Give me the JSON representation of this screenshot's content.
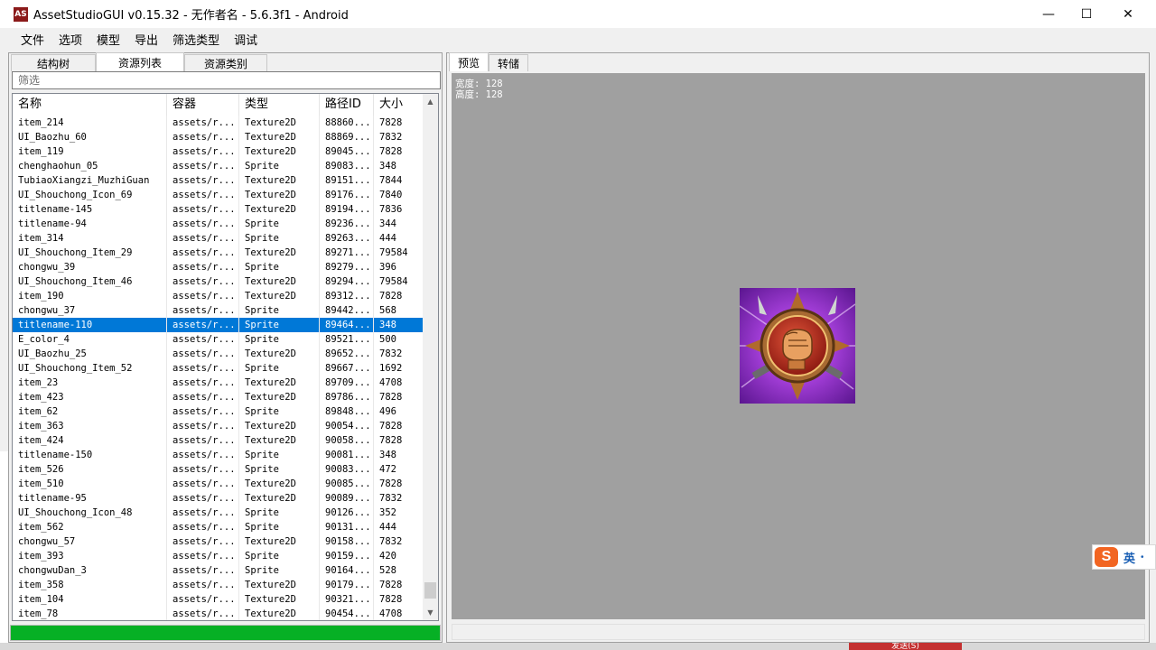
{
  "window": {
    "icon_text": "AS",
    "title": "AssetStudioGUI v0.15.32 - 无作者名 - 5.6.3f1 - Android",
    "minimize": "—",
    "maximize": "☐",
    "close": "✕"
  },
  "menu": [
    "文件",
    "选项",
    "模型",
    "导出",
    "筛选类型",
    "调试"
  ],
  "left_tabs": [
    "结构树",
    "资源列表",
    "资源类别"
  ],
  "filter_placeholder": "筛选",
  "columns": [
    "名称",
    "容器",
    "类型",
    "路径ID",
    "大小"
  ],
  "rows": [
    [
      "item_214",
      "assets/r...",
      "Texture2D",
      "88860...",
      "7828"
    ],
    [
      "UI_Baozhu_60",
      "assets/r...",
      "Texture2D",
      "88869...",
      "7832"
    ],
    [
      "item_119",
      "assets/r...",
      "Texture2D",
      "89045...",
      "7828"
    ],
    [
      "chenghaohun_05",
      "assets/r...",
      "Sprite",
      "89083...",
      "348"
    ],
    [
      "TubiaoXiangzi_MuzhiGuan",
      "assets/r...",
      "Texture2D",
      "89151...",
      "7844"
    ],
    [
      "UI_Shouchong_Icon_69",
      "assets/r...",
      "Texture2D",
      "89176...",
      "7840"
    ],
    [
      "titlename-145",
      "assets/r...",
      "Texture2D",
      "89194...",
      "7836"
    ],
    [
      "titlename-94",
      "assets/r...",
      "Sprite",
      "89236...",
      "344"
    ],
    [
      "item_314",
      "assets/r...",
      "Sprite",
      "89263...",
      "444"
    ],
    [
      "UI_Shouchong_Item_29",
      "assets/r...",
      "Texture2D",
      "89271...",
      "79584"
    ],
    [
      "chongwu_39",
      "assets/r...",
      "Sprite",
      "89279...",
      "396"
    ],
    [
      "UI_Shouchong_Item_46",
      "assets/r...",
      "Texture2D",
      "89294...",
      "79584"
    ],
    [
      "item_190",
      "assets/r...",
      "Texture2D",
      "89312...",
      "7828"
    ],
    [
      "chongwu_37",
      "assets/r...",
      "Sprite",
      "89442...",
      "568"
    ],
    [
      "titlename-110",
      "assets/r...",
      "Sprite",
      "89464...",
      "348"
    ],
    [
      "E_color_4",
      "assets/r...",
      "Sprite",
      "89521...",
      "500"
    ],
    [
      "UI_Baozhu_25",
      "assets/r...",
      "Texture2D",
      "89652...",
      "7832"
    ],
    [
      "UI_Shouchong_Item_52",
      "assets/r...",
      "Sprite",
      "89667...",
      "1692"
    ],
    [
      "item_23",
      "assets/r...",
      "Texture2D",
      "89709...",
      "4708"
    ],
    [
      "item_423",
      "assets/r...",
      "Texture2D",
      "89786...",
      "7828"
    ],
    [
      "item_62",
      "assets/r...",
      "Sprite",
      "89848...",
      "496"
    ],
    [
      "item_363",
      "assets/r...",
      "Texture2D",
      "90054...",
      "7828"
    ],
    [
      "item_424",
      "assets/r...",
      "Texture2D",
      "90058...",
      "7828"
    ],
    [
      "titlename-150",
      "assets/r...",
      "Sprite",
      "90081...",
      "348"
    ],
    [
      "item_526",
      "assets/r...",
      "Sprite",
      "90083...",
      "472"
    ],
    [
      "item_510",
      "assets/r...",
      "Texture2D",
      "90085...",
      "7828"
    ],
    [
      "titlename-95",
      "assets/r...",
      "Texture2D",
      "90089...",
      "7832"
    ],
    [
      "UI_Shouchong_Icon_48",
      "assets/r...",
      "Sprite",
      "90126...",
      "352"
    ],
    [
      "item_562",
      "assets/r...",
      "Sprite",
      "90131...",
      "444"
    ],
    [
      "chongwu_57",
      "assets/r...",
      "Texture2D",
      "90158...",
      "7832"
    ],
    [
      "item_393",
      "assets/r...",
      "Sprite",
      "90159...",
      "420"
    ],
    [
      "chongwuDan_3",
      "assets/r...",
      "Sprite",
      "90164...",
      "528"
    ],
    [
      "item_358",
      "assets/r...",
      "Texture2D",
      "90179...",
      "7828"
    ],
    [
      "item_104",
      "assets/r...",
      "Texture2D",
      "90321...",
      "7828"
    ],
    [
      "item_78",
      "assets/r...",
      "Texture2D",
      "90454...",
      "4708"
    ]
  ],
  "selected_row": 14,
  "progress": 1.0,
  "right_tabs": [
    "预览",
    "转储"
  ],
  "preview": {
    "width_line": "宽度: 128",
    "height_line": "高度: 128"
  },
  "ime": {
    "logo": "S",
    "lang": "英",
    "dot": "•"
  },
  "send_button": "发送(S)",
  "colors": {
    "selection": "#0078d7",
    "progress": "#06b025",
    "preview_bg": "#a0a0a0"
  }
}
